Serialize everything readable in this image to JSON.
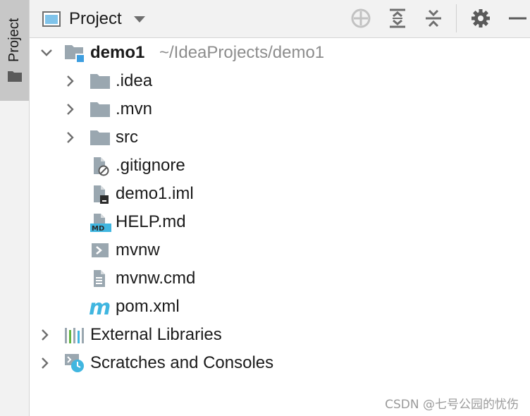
{
  "tool_window": {
    "strip_tab_label": "Project",
    "view_selector_label": "Project"
  },
  "toolbar": {
    "icons": [
      "locate-icon",
      "expand-all-icon",
      "collapse-all-icon",
      "gear-icon",
      "hide-icon"
    ]
  },
  "tree": {
    "root": {
      "name": "demo1",
      "path": "~/IdeaProjects/demo1"
    },
    "children": [
      {
        "label": ".idea",
        "type": "folder"
      },
      {
        "label": ".mvn",
        "type": "folder"
      },
      {
        "label": "src",
        "type": "folder"
      },
      {
        "label": ".gitignore",
        "type": "ignore-file"
      },
      {
        "label": "demo1.iml",
        "type": "iml-file"
      },
      {
        "label": "HELP.md",
        "type": "markdown-file"
      },
      {
        "label": "mvnw",
        "type": "shell-script"
      },
      {
        "label": "mvnw.cmd",
        "type": "text-file"
      },
      {
        "label": "pom.xml",
        "type": "maven-pom"
      }
    ],
    "external_libraries": "External Libraries",
    "scratches": "Scratches and Consoles"
  },
  "watermark": "CSDN @七号公园的忧伤",
  "colors": {
    "accent_blue": "#3d9ee0",
    "folder_gray": "#9aa7b0",
    "maven_blue": "#40b6e0"
  }
}
